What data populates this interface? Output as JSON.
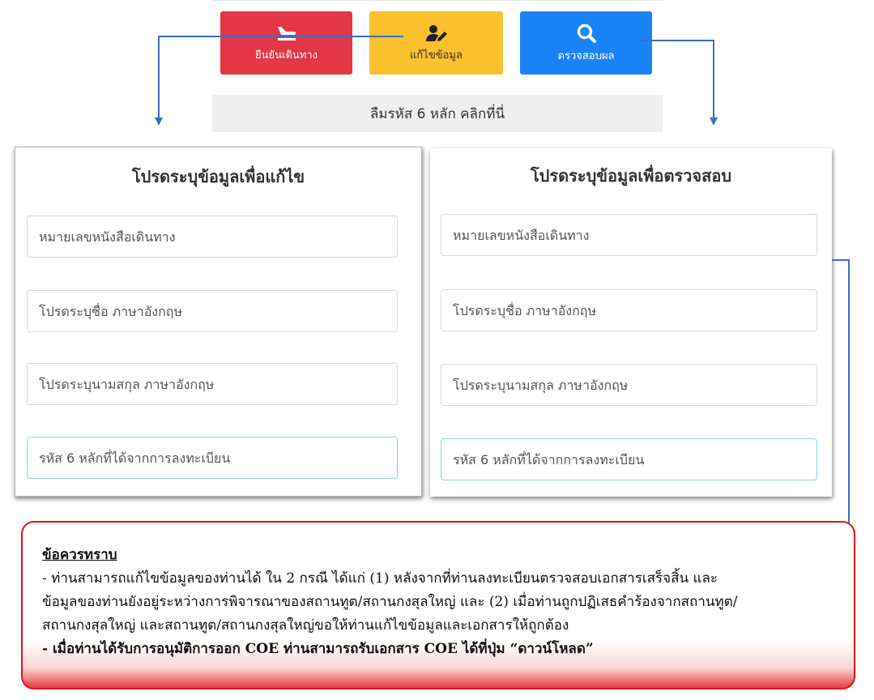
{
  "top_actions": {
    "confirm_label": "ยืนยันเดินทาง",
    "edit_label": "แก้ไขข้อมูล",
    "check_label": "ตรวจสอบผล",
    "forgot_label": "ลืมรหัส 6 หลัก คลิกที่นี่"
  },
  "colors": {
    "confirm": "#e33745",
    "edit": "#fbc02d",
    "check": "#1a82f7",
    "arrow": "#3a6fc2",
    "notice_border": "#e3151a"
  },
  "edit_panel": {
    "title": "โปรดระบุข้อมูลเพื่อแก้ไข",
    "fields": [
      {
        "placeholder": "หมายเลขหนังสือเดินทาง"
      },
      {
        "placeholder": "โปรดระบุชื่อ ภาษาอังกฤษ"
      },
      {
        "placeholder": "โปรดระบุนามสกุล ภาษาอังกฤษ"
      },
      {
        "placeholder": "รหัส 6 หลักที่ได้จากการลงทะเบียน"
      }
    ]
  },
  "check_panel": {
    "title": "โปรดระบุข้อมูลเพื่อตรวจสอบ",
    "fields": [
      {
        "placeholder": "หมายเลขหนังสือเดินทาง"
      },
      {
        "placeholder": "โปรดระบุชื่อ ภาษาอังกฤษ"
      },
      {
        "placeholder": "โปรดระบุนามสกุล ภาษาอังกฤษ"
      },
      {
        "placeholder": "รหัส 6 หลักที่ได้จากการลงทะเบียน"
      }
    ]
  },
  "notice": {
    "title": "ข้อควรทราบ",
    "body_lines": [
      "- ท่านสามารถแก้ไขข้อมูลของท่านได้ ใน 2 กรณี ได้แก่ (1) หลังจากที่ท่านลงทะเบียนตรวจสอบเอกสารเสร็จสิ้น และ",
      "ข้อมูลของท่านยังอยู่ระหว่างการพิจารณาของสถานทูต/สถานกงสุลใหญ่ และ (2) เมื่อท่านถูกปฏิเสธคำร้องจากสถานทูต/",
      "สถานกงสุลใหญ่ และสถานทูต/สถานกงสุลใหญ่ขอให้ท่านแก้ไขข้อมูลและเอกสารให้ถูกต้อง"
    ],
    "bold_line": "- เมื่อท่านได้รับการอนุมัติการออก COE ท่านสามารถรับเอกสาร COE ได้ที่ปุ่ม “ดาวน์โหลด”"
  },
  "icons": {
    "confirm": "plane-landing-icon",
    "edit": "user-edit-icon",
    "check": "search-icon"
  }
}
